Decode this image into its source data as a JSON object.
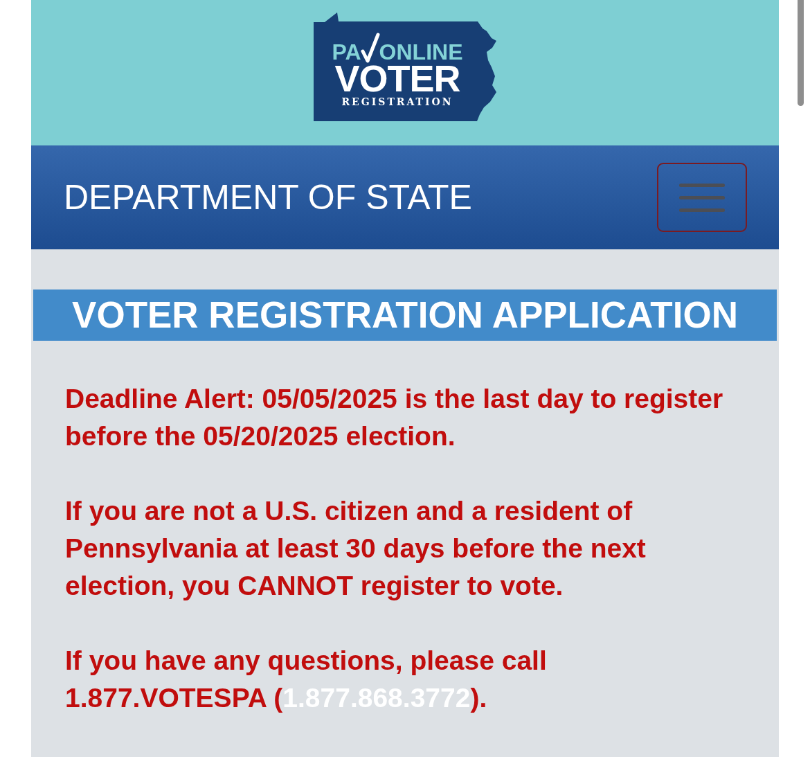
{
  "header": {
    "logo": {
      "prefix": "PA",
      "title": "ONLINE",
      "main": "VOTER",
      "subtitle": "REGISTRATION"
    }
  },
  "navbar": {
    "title": "DEPARTMENT OF STATE"
  },
  "page_title": "VOTER REGISTRATION APPLICATION",
  "notices": [
    {
      "kind": "text",
      "text": "Deadline Alert: 05/05/2025 is the last day to register before the 05/20/2025 election."
    },
    {
      "kind": "text",
      "text": "If you are not a U.S. citizen and a resident of Pennsylvania at least 30 days before the next election, you CANNOT register to vote."
    },
    {
      "kind": "link",
      "text": "If you have any questions, please call 1.877.VOTESPA (",
      "link": "1.877.868.3772",
      "text_after": ")."
    }
  ]
}
